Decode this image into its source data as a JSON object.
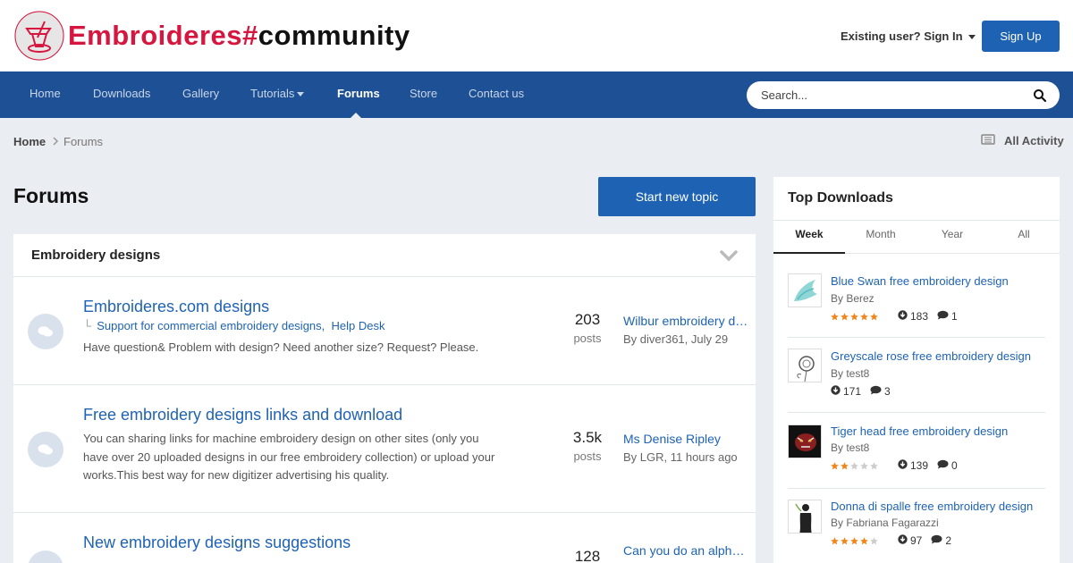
{
  "header": {
    "logo_text_red": "Embroideres#",
    "logo_text_dark": "community",
    "signin_label": "Existing user? Sign In",
    "signup_label": "Sign Up"
  },
  "nav": {
    "items": [
      {
        "label": "Home"
      },
      {
        "label": "Downloads"
      },
      {
        "label": "Gallery"
      },
      {
        "label": "Tutorials"
      },
      {
        "label": "Forums"
      },
      {
        "label": "Store"
      },
      {
        "label": "Contact us"
      }
    ],
    "active": "Forums"
  },
  "search": {
    "placeholder": "Search..."
  },
  "breadcrumb": {
    "home": "Home",
    "current": "Forums"
  },
  "all_activity": "All Activity",
  "page_title": "Forums",
  "start_topic": "Start new topic",
  "section": {
    "title": "Embroidery designs",
    "forums": [
      {
        "title": "Embroideres.com designs",
        "subforums": [
          "Support for commercial embroidery designs,",
          "Help Desk"
        ],
        "description": "Have question& Problem with design? Need another size? Request? Please.",
        "posts": "203",
        "posts_label": "posts",
        "last_title": "Wilbur embroidery design",
        "last_by": "By diver361, July 29"
      },
      {
        "title": "Free embroidery designs links and download",
        "description": "You can sharing links for machine embroidery design on other sites (only you have over 20 uploaded designs in our free  embroidery collection) or upload your works.This best way for new digitizer advertising his quality.",
        "posts": "3.5k",
        "posts_label": "posts",
        "last_title": "Ms Denise Ripley",
        "last_by": "By LGR, 11 hours ago"
      },
      {
        "title": "New embroidery designs suggestions",
        "posts": "128",
        "last_title": "Can you do an alphabet?"
      }
    ]
  },
  "sidebar": {
    "title": "Top Downloads",
    "tabs": [
      "Week",
      "Month",
      "Year",
      "All"
    ],
    "active_tab": "Week",
    "downloads": [
      {
        "title": "Blue Swan free embroidery design",
        "by": "By Berez",
        "rating": 5,
        "downloads": "183",
        "comments": "1"
      },
      {
        "title": "Greyscale rose free embroidery design",
        "by": "By test8",
        "rating": 0,
        "downloads": "171",
        "comments": "3"
      },
      {
        "title": "Tiger head free embroidery design",
        "by": "By test8",
        "rating": 2,
        "downloads": "139",
        "comments": "0"
      },
      {
        "title": "Donna di spalle free embroidery design",
        "by": "By Fabriana Fagarazzi",
        "rating": 4,
        "downloads": "97",
        "comments": "2"
      }
    ]
  },
  "colors": {
    "brand_red": "#d6163f",
    "nav_blue": "#1d5094",
    "button_blue": "#1e63b3",
    "link_blue": "#1e63b3",
    "star_orange": "#f0851a"
  }
}
